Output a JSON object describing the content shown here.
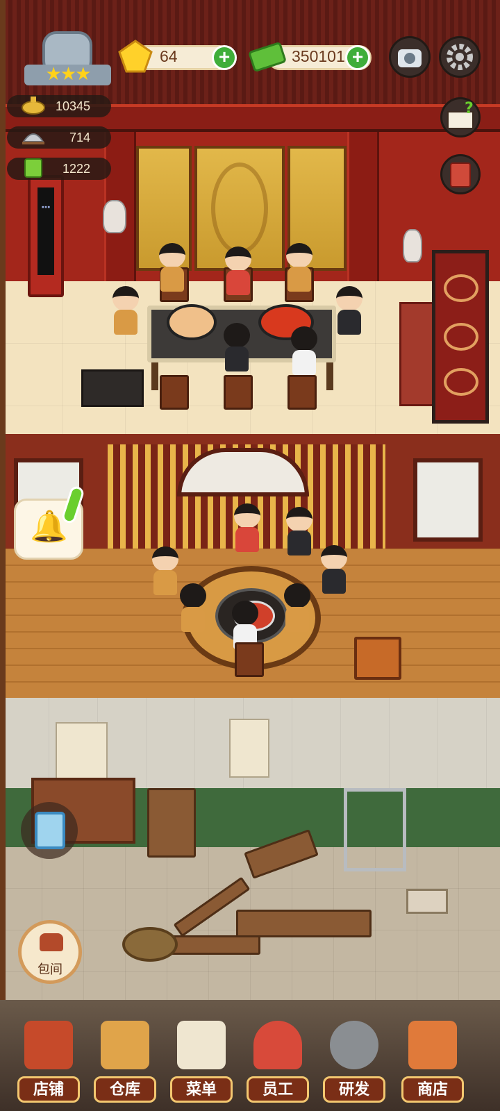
{
  "hud": {
    "gems": "64",
    "cash": "350101",
    "stats": [
      {
        "name": "hotpot-icon",
        "value": "10345"
      },
      {
        "name": "dish-cover-icon",
        "value": "714"
      },
      {
        "name": "recipe-book-icon",
        "value": "1222"
      }
    ],
    "rating_stars": "★★★",
    "rating_stars_count": 3
  },
  "room_button": {
    "label": "包间"
  },
  "nav": [
    {
      "label": "店铺",
      "icon": "storefront-icon"
    },
    {
      "label": "仓库",
      "icon": "boxes-icon"
    },
    {
      "label": "菜单",
      "icon": "menu-clipboard-icon"
    },
    {
      "label": "员工",
      "icon": "staff-icon"
    },
    {
      "label": "研发",
      "icon": "wok-icon"
    },
    {
      "label": "商店",
      "icon": "shop-icon"
    }
  ],
  "colors": {
    "accent_green": "#3fae3a",
    "nav_label_bg": "#7a2e16",
    "nav_label_border": "#f3c770",
    "star": "#ffd21a"
  }
}
